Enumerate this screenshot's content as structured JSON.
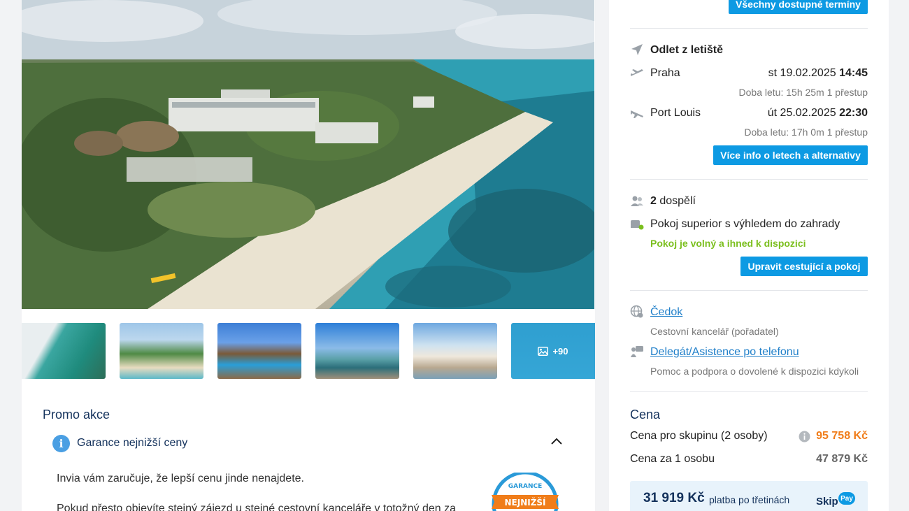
{
  "gallery": {
    "more_label": "+90"
  },
  "promo": {
    "section_title": "Promo akce",
    "guarantee_title": "Garance nejnižší ceny",
    "para1": "Invia vám zaručuje, že lepší cenu jinde nenajdete.",
    "para2": "Pokud přesto objevíte stejný zájezd u stejné cestovní kanceláře v totožný den za",
    "badge_top": "GARANCE",
    "badge_mid": "NEJNIŽŠÍ"
  },
  "sidebar": {
    "all_dates_button": "Všechny dostupné termíny",
    "departure_heading": "Odlet z letiště",
    "outbound": {
      "city": "Praha",
      "date": "st 19.02.2025",
      "time": "14:45",
      "info": "Doba letu: 15h 25m  1 přestup"
    },
    "return": {
      "city": "Port Louis",
      "date": "út 25.02.2025",
      "time": "22:30",
      "info": "Doba letu: 17h 0m  1 přestup"
    },
    "flights_button": "Více info o letech a alternativy",
    "travellers_count": "2",
    "travellers_label": "dospělí",
    "room": "Pokoj superior s výhledem do zahrady",
    "room_status": "Pokoj je volný a ihned k dispozici",
    "edit_button": "Upravit cestující a pokoj",
    "agency_link": "Čedok",
    "agency_desc": "Cestovní kancelář (pořadatel)",
    "support_link": "Delegát/Asistence po telefonu",
    "support_desc": "Pomoc a podpora o dovolené k dispozici kdykoli",
    "price_title": "Cena",
    "group_label": "Cena pro skupinu (2 osoby)",
    "group_price": "95 758 Kč",
    "person_label": "Cena za 1 osobu",
    "person_price": "47 879 Kč",
    "installment_amount": "31 919 Kč",
    "installment_text": "platba po třetinách",
    "skip_word": "Skip",
    "pay_word": "Pay"
  },
  "colors": {
    "accent": "#0d9ae3",
    "navy": "#14325c",
    "orange": "#f07d1a",
    "green": "#7bbf1e"
  }
}
